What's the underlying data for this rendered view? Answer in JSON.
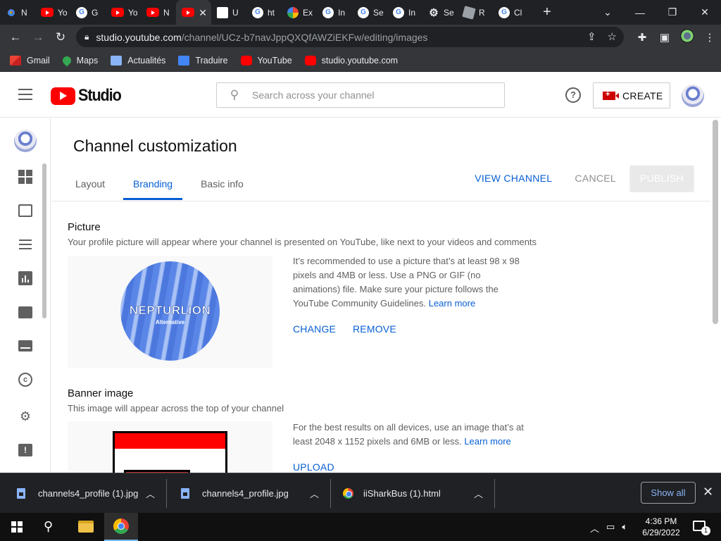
{
  "browser": {
    "tabs": [
      {
        "icon": "chrome-icon",
        "title": "N"
      },
      {
        "icon": "youtube-icon",
        "title": "Yo"
      },
      {
        "icon": "google-icon",
        "title": "G"
      },
      {
        "icon": "youtube-icon",
        "title": "Yo"
      },
      {
        "icon": "youtube-icon",
        "title": "N"
      },
      {
        "icon": "youtube-icon",
        "title": "",
        "active": true
      },
      {
        "icon": "page-icon",
        "title": "U"
      },
      {
        "icon": "google-icon",
        "title": "ht"
      },
      {
        "icon": "pinwheel-icon",
        "title": "Ex"
      },
      {
        "icon": "google-icon",
        "title": "In"
      },
      {
        "icon": "google-icon",
        "title": "Se"
      },
      {
        "icon": "google-icon",
        "title": "In"
      },
      {
        "icon": "gear-icon",
        "title": "Se"
      },
      {
        "icon": "roblox-icon",
        "title": "R"
      },
      {
        "icon": "google-icon",
        "title": "Cl"
      }
    ],
    "url_host": "studio.youtube.com",
    "url_path": "/channel/UCz-b7navJppQXQfAWZiEKFw/editing/images"
  },
  "bookmarks": [
    {
      "icon": "gmail-icon",
      "label": "Gmail"
    },
    {
      "icon": "maps-icon",
      "label": "Maps"
    },
    {
      "icon": "news-icon",
      "label": "Actualités"
    },
    {
      "icon": "translate-icon",
      "label": "Traduire"
    },
    {
      "icon": "youtube-icon",
      "label": "YouTube"
    },
    {
      "icon": "youtube-icon",
      "label": "studio.youtube.com"
    }
  ],
  "studio": {
    "logo_text": "Studio",
    "search_placeholder": "Search across your channel",
    "help_glyph": "?",
    "create_label": "CREATE"
  },
  "page": {
    "title": "Channel customization",
    "tabs": [
      "Layout",
      "Branding",
      "Basic info"
    ],
    "active_tab": "Branding",
    "view_channel": "VIEW CHANNEL",
    "cancel": "CANCEL",
    "publish": "PUBLISH"
  },
  "picture": {
    "title": "Picture",
    "description": "Your profile picture will appear where your channel is presented on YouTube, like next to your videos and comments",
    "image_text": "NEPTURLION",
    "image_subtext": "Alternative",
    "info": "It’s recommended to use a picture that’s at least 98 x 98 pixels and 4MB or less. Use a PNG or GIF (no animations) file. Make sure your picture follows the YouTube Community Guidelines.",
    "learn_more": "Learn more",
    "change": "CHANGE",
    "remove": "REMOVE"
  },
  "banner": {
    "title": "Banner image",
    "description": "This image will appear across the top of your channel",
    "info": "For the best results on all devices, use an image that’s at least 2048 x 1152 pixels and 6MB or less.",
    "learn_more": "Learn more",
    "upload": "UPLOAD"
  },
  "downloads": {
    "items": [
      {
        "icon": "image-file-icon",
        "name": "channels4_profile (1).jpg"
      },
      {
        "icon": "image-file-icon",
        "name": "channels4_profile.jpg"
      },
      {
        "icon": "chrome-icon",
        "name": "iiSharkBus (1).html"
      }
    ],
    "show_all": "Show all"
  },
  "taskbar": {
    "time": "4:36 PM",
    "date": "6/29/2022",
    "notification_count": "1"
  },
  "colors": {
    "accent_blue": "#065fd4",
    "youtube_red": "#ff0000",
    "chrome_dark": "#202124"
  }
}
